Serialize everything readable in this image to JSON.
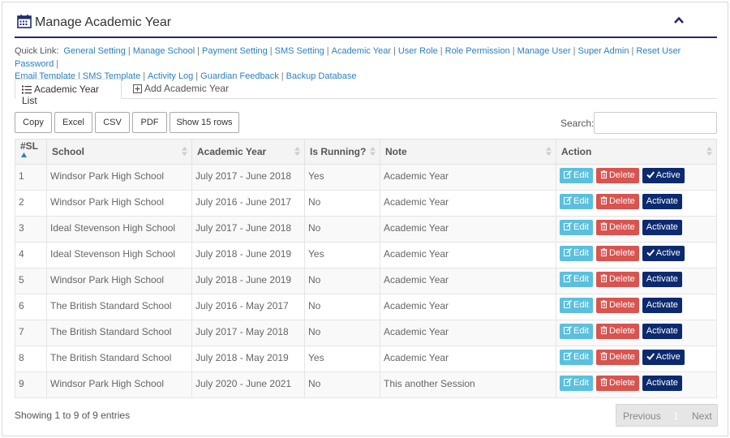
{
  "header": {
    "title": "Manage Academic Year",
    "title_icon": "calendar-icon",
    "collapse_icon": "chevron-up-icon"
  },
  "quick_links": {
    "label": "Quick Link:",
    "items": [
      "General Setting",
      "Manage School",
      "Payment Setting",
      "SMS Setting",
      "Academic Year",
      "User Role",
      "Role Permission",
      "Manage User",
      "Super Admin",
      "Reset User Password",
      "Email Template",
      "SMS Template",
      "Activity Log",
      "Guardian Feedback",
      "Backup Database"
    ]
  },
  "tabs": [
    {
      "label": "Academic Year List",
      "icon": "list-icon"
    },
    {
      "label": "Add Academic Year",
      "icon": "plus-square-icon"
    }
  ],
  "toolbar": {
    "buttons": [
      "Copy",
      "Excel",
      "CSV",
      "PDF",
      "Show 15 rows"
    ],
    "search_label": "Search:",
    "search_value": ""
  },
  "table": {
    "columns": [
      "#SL",
      "School",
      "Academic Year",
      "Is Running?",
      "Note",
      "Action"
    ],
    "rows": [
      [
        "1",
        "Windsor Park High School",
        "July 2017 - June 2018",
        "Yes",
        "Academic Year"
      ],
      [
        "2",
        "Windsor Park High School",
        "July 2016 - June 2017",
        "No",
        "Academic Year"
      ],
      [
        "3",
        "Ideal Stevenson High School",
        "July 2017 - June 2018",
        "No",
        "Academic Year"
      ],
      [
        "4",
        "Ideal Stevenson High School",
        "July 2018 - June 2019",
        "Yes",
        "Academic Year"
      ],
      [
        "5",
        "Windsor Park High School",
        "July 2018 - June 2019",
        "No",
        "Academic Year"
      ],
      [
        "6",
        "The British Standard School",
        "July 2016 - May 2017",
        "No",
        "Academic Year"
      ],
      [
        "7",
        "The British Standard School",
        "July 2017 - May 2018",
        "No",
        "Academic Year"
      ],
      [
        "8",
        "The British Standard School",
        "July 2018 - May 2019",
        "Yes",
        "Academic Year"
      ],
      [
        "9",
        "Windsor Park High School",
        "July 2020 - June 2021",
        "No",
        "This another Session"
      ]
    ],
    "actions": {
      "edit": "Edit",
      "delete": "Delete",
      "active": "Active",
      "activate": "Activate"
    }
  },
  "footer": {
    "info": "Showing 1 to 9 of 9 entries",
    "previous": "Previous",
    "page": "1",
    "next": "Next"
  },
  "colors": {
    "accent_navy": "#0b2a6f",
    "edit": "#5bc0de",
    "delete": "#d9534f",
    "link": "#2a7fc1"
  }
}
